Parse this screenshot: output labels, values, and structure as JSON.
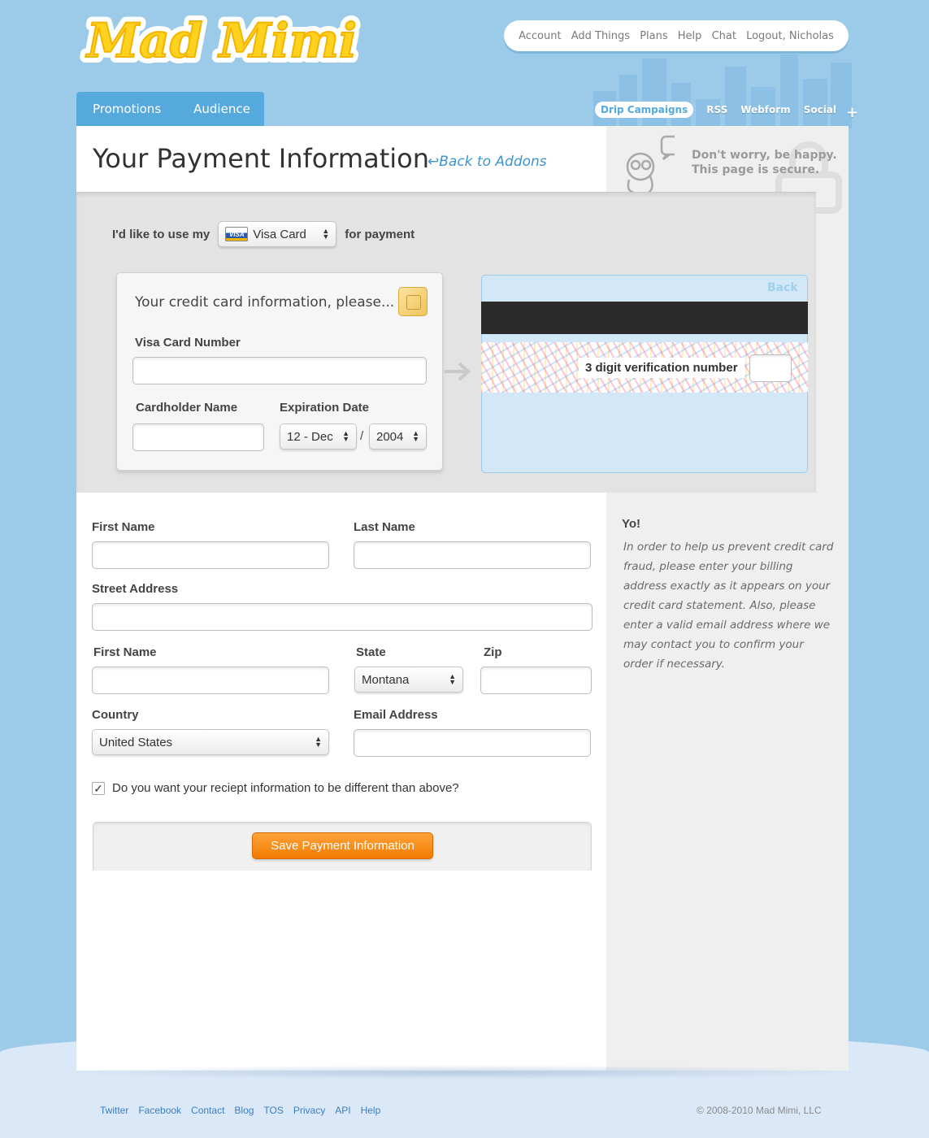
{
  "logo": {
    "text": "Mad Mimi"
  },
  "top_nav": {
    "items": [
      "Account",
      "Add Things",
      "Plans",
      "Help",
      "Chat",
      "Logout, Nicholas"
    ]
  },
  "main_tabs": [
    "Promotions",
    "Audience"
  ],
  "sub_tabs": {
    "items": [
      "Drip Campaigns",
      "RSS",
      "Webform",
      "Social"
    ],
    "active": "Drip Campaigns",
    "plus": "+"
  },
  "header": {
    "title": "Your Payment Information",
    "back_link": "Back to Addons",
    "secure_line1": "Don't worry, be happy.",
    "secure_line2": "This page is secure."
  },
  "payment": {
    "prefix": "I'd like to use my",
    "card_type": "Visa Card",
    "card_badge": "VISA",
    "suffix": "for payment",
    "front_title": "Your credit card information, please...",
    "card_number_label": "Visa Card Number",
    "cardholder_label": "Cardholder Name",
    "expiration_label": "Expiration Date",
    "exp_month": "12 - Dec",
    "exp_separator": "/",
    "exp_year": "2004",
    "back_label": "Back",
    "cvv_label": "3 digit verification number"
  },
  "billing": {
    "first_name_label": "First Name",
    "last_name_label": "Last Name",
    "street_label": "Street Address",
    "city_label": "First Name",
    "state_label": "State",
    "state_value": "Montana",
    "zip_label": "Zip",
    "country_label": "Country",
    "country_value": "United States",
    "email_label": "Email Address",
    "checkbox_label": "Do you want your reciept information to be different than above?",
    "checkbox_checked": true,
    "save_button": "Save Payment Information"
  },
  "sidebar": {
    "title": "Yo!",
    "text": "In order to help us prevent credit card fraud, please enter your billing address exactly as it appears on your credit card statement. Also, please enter a valid email address where we may contact you to confirm your order if necessary."
  },
  "footer": {
    "links": [
      "Twitter",
      "Facebook",
      "Contact",
      "Blog",
      "TOS",
      "Privacy",
      "API",
      "Help"
    ],
    "copyright": "© 2008-2010 Mad Mimi, LLC"
  },
  "colors": {
    "background": "#9ccbe9",
    "accent": "#55a9dd",
    "orange": "#f27a00",
    "logo_yellow": "#ffd21f"
  }
}
